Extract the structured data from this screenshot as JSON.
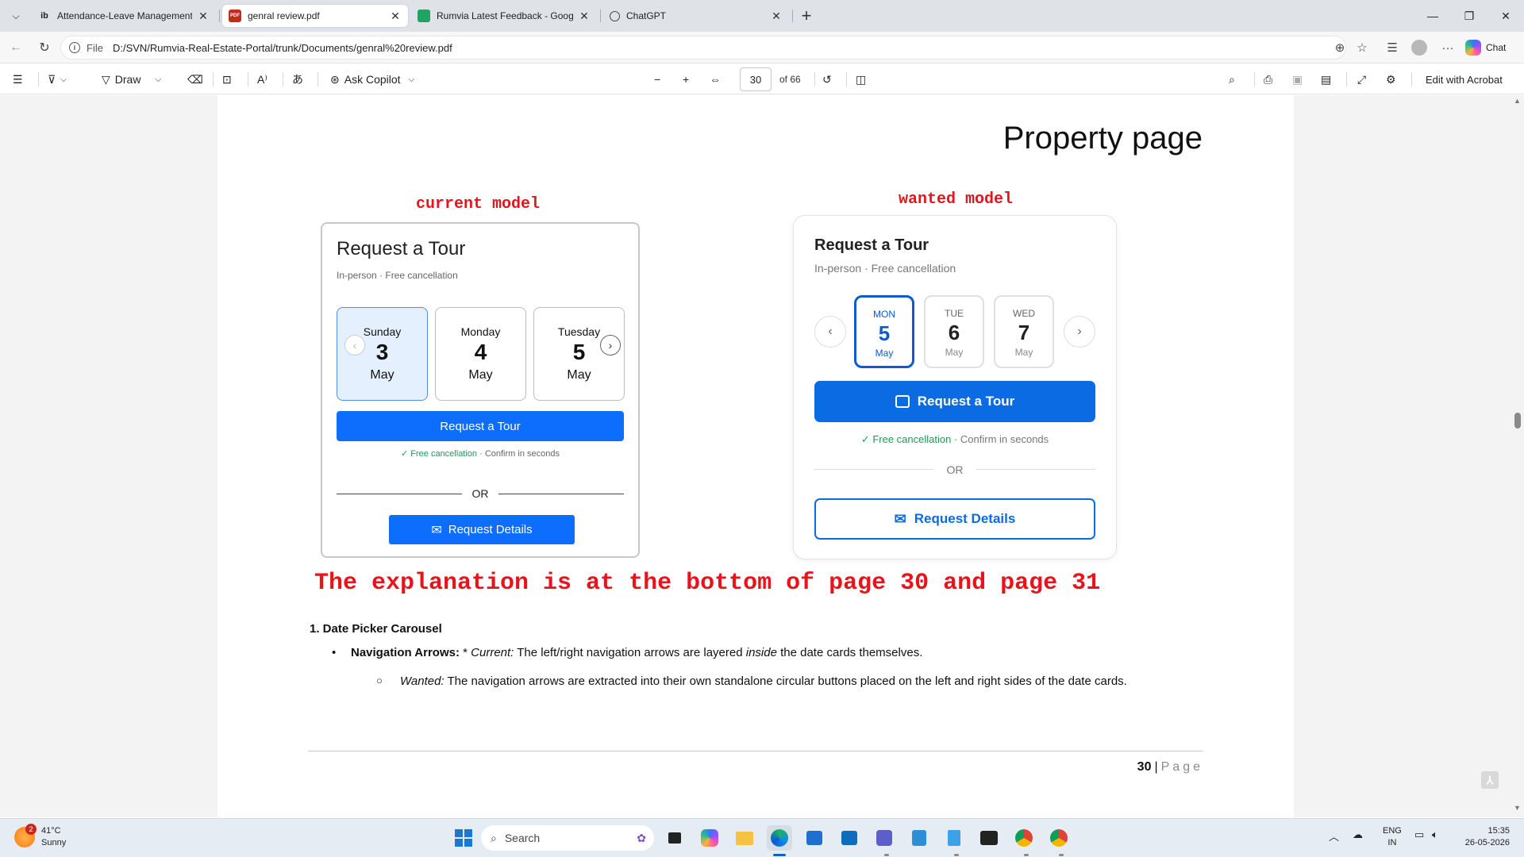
{
  "tabs": [
    {
      "label": "Attendance-Leave Management Sy",
      "favicon": "ib",
      "active": false
    },
    {
      "label": "genral review.pdf",
      "favicon": "PDF",
      "active": true
    },
    {
      "label": "Rumvia Latest Feedback - Google",
      "favicon": "sheets",
      "active": false
    },
    {
      "label": "ChatGPT",
      "favicon": "chatgpt",
      "active": false
    }
  ],
  "address": {
    "scheme": "File",
    "url": "D:/SVN/Rumvia-Real-Estate-Portal/trunk/Documents/genral%20review.pdf",
    "chat_label": "Chat"
  },
  "pdf_toolbar": {
    "draw_label": "Draw",
    "copilot_label": "Ask Copilot",
    "page_current": "30",
    "page_of": "of 66",
    "acrobat_label": "Edit with Acrobat"
  },
  "page": {
    "title": "Property page",
    "current_label": "current model",
    "wanted_label": "wanted model",
    "current_card": {
      "heading": "Request a Tour",
      "subtitle": "In-person · Free cancellation",
      "dates": [
        {
          "weekday": "Sunday",
          "day": "3",
          "month": "May",
          "selected": true
        },
        {
          "weekday": "Monday",
          "day": "4",
          "month": "May",
          "selected": false
        },
        {
          "weekday": "Tuesday",
          "day": "5",
          "month": "May",
          "selected": false
        }
      ],
      "tour_button": "Request a Tour",
      "free_check": "✓ Free cancellation",
      "free_rest": " · Confirm in seconds",
      "or": "OR",
      "details_button": "Request Details"
    },
    "wanted_card": {
      "heading": "Request a Tour",
      "subtitle": "In-person · Free cancellation",
      "dates": [
        {
          "weekday": "MON",
          "day": "5",
          "month": "May",
          "selected": true
        },
        {
          "weekday": "TUE",
          "day": "6",
          "month": "May",
          "selected": false
        },
        {
          "weekday": "WED",
          "day": "7",
          "month": "May",
          "selected": false
        }
      ],
      "tour_button": "Request a Tour",
      "free_check": "✓ Free cancellation",
      "free_rest": "  ·  Confirm in seconds",
      "or": "OR",
      "details_button": "Request Details"
    },
    "explanation": "The explanation is at the bottom of page 30 and page 31",
    "section_heading": "1. Date Picker Carousel",
    "bullet1_bold": "Navigation Arrows:",
    "bullet1_pre": " * ",
    "bullet1_italic": "Current:",
    "bullet1_mid": " The left/right navigation arrows are layered ",
    "bullet1_italic2": "inside",
    "bullet1_end": " the date cards themselves.",
    "bullet2_italic": "Wanted:",
    "bullet2_text": " The navigation arrows are extracted into their own standalone circular buttons placed on the left and right sides of the date cards.",
    "footer_page": "30",
    "footer_sep": "|",
    "footer_label": "Page"
  },
  "taskbar": {
    "temp": "41°C",
    "weather": "Sunny",
    "weather_badge": "2",
    "search_placeholder": "Search",
    "lang": "ENG",
    "region": "IN",
    "time": "15:35",
    "date": "26-05-2026"
  },
  "colors": {
    "accent_red": "#e8131b",
    "primary_blue": "#0d6efd",
    "wanted_blue": "#0a6be3",
    "green_check": "#1a9b5a"
  }
}
